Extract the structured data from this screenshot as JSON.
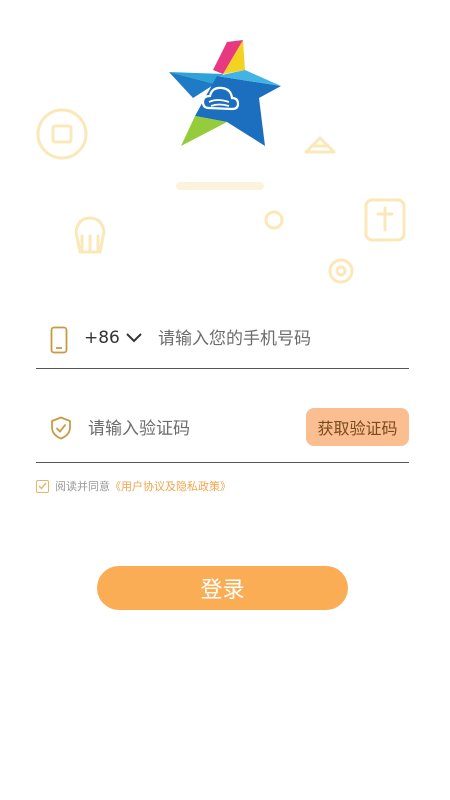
{
  "phone": {
    "country_code": "+86",
    "placeholder": "请输入您的手机号码",
    "value": ""
  },
  "verification": {
    "placeholder": "请输入验证码",
    "value": "",
    "get_code_label": "获取验证码"
  },
  "agreement": {
    "checked": true,
    "text": "阅读并同意",
    "link_text": "《用户协议及隐私政策》"
  },
  "login_label": "登录",
  "colors": {
    "accent": "#fbad55",
    "button_light": "#fbbe90",
    "link": "#eea64c",
    "logo_blue": "#1f7bc6",
    "logo_green": "#95cc3c",
    "logo_pink": "#e8387f",
    "logo_yellow": "#f3d31f"
  },
  "icons": [
    "app-logo-icon",
    "phone-icon",
    "chevron-down-icon",
    "shield-check-icon",
    "checkmark-icon"
  ]
}
